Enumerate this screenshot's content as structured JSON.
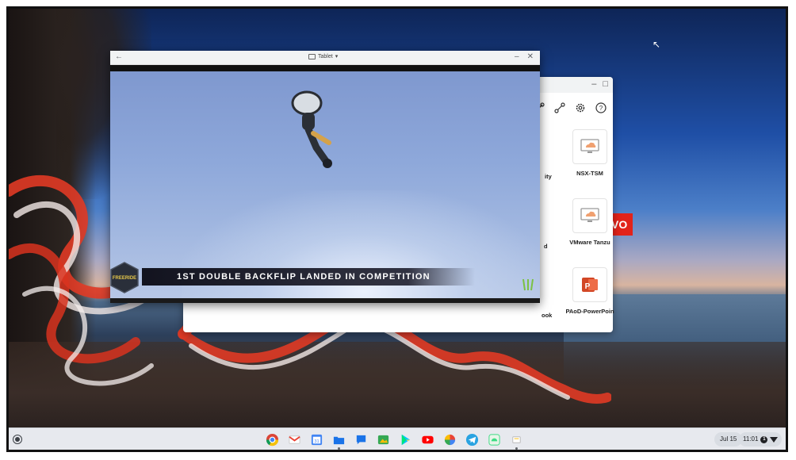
{
  "desktop": {
    "brand_text": "VO"
  },
  "video_window": {
    "mode_label": "Tablet",
    "caption": "1ST DOUBLE BACKFLIP LANDED IN COMPETITION",
    "badge_text": "FREERIDE"
  },
  "app_window": {
    "tiles": [
      {
        "label": "NSX-TSM",
        "icon": "cloud-monitor-icon"
      },
      {
        "label": "VMware Tanzu",
        "icon": "cloud-monitor-icon"
      },
      {
        "label": "PAoD-PowerPoin",
        "icon": "powerpoint-icon"
      }
    ],
    "partial_labels": [
      "ity",
      "d",
      "ook"
    ]
  },
  "shelf": {
    "apps": [
      "chrome",
      "gmail",
      "calendar",
      "files",
      "messages",
      "photos-editor",
      "play-store",
      "youtube",
      "photos",
      "telegram",
      "android-app",
      "notes"
    ],
    "date": "Jul 15",
    "time": "11:01"
  },
  "colors": {
    "lenovo_red": "#e2231a",
    "shelf_bg": "#e7e9ee"
  }
}
